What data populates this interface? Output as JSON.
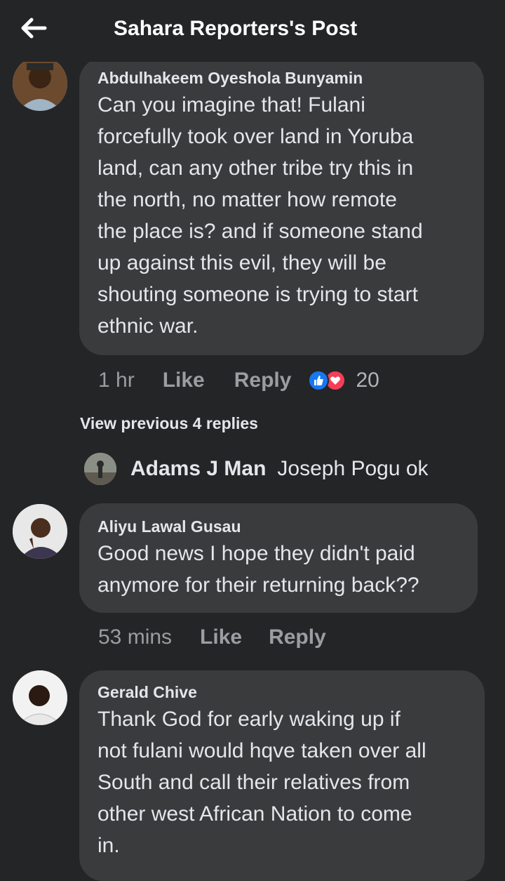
{
  "header": {
    "back_icon": "arrow-left-icon",
    "title": "Sahara Reporters's Post"
  },
  "comments": [
    {
      "author": "Abdulhakeem Oyeshola Bunyamin",
      "text": "Can you imagine that! Fulani\nforcefully took over land in Yoruba\nland, can any other tribe try this in\nthe north, no matter how remote\nthe place is? and if someone stand\nup against this evil, they will be\nshouting someone is trying to start\nethnic war.",
      "time": "1 hr",
      "like_label": "Like",
      "reply_label": "Reply",
      "reactions": [
        "like-icon",
        "love-icon"
      ],
      "reaction_count": "20"
    },
    {
      "author": "Aliyu Lawal Gusau",
      "text": "Good news I hope they didn't paid\nanymore for their returning back??",
      "time": "53 mins",
      "like_label": "Like",
      "reply_label": "Reply"
    },
    {
      "author": "Gerald Chive",
      "text": "Thank God for early waking up if\nnot fulani would hqve taken over all\nSouth and call their relatives from\nother west African Nation to come\nin."
    }
  ],
  "replies": {
    "view_previous": "View previous 4 replies",
    "latest": {
      "author": "Adams J Man",
      "text": "Joseph Pogu ok"
    }
  },
  "colors": {
    "background": "#242526",
    "bubble": "#3a3b3c",
    "text": "#e4e6eb",
    "muted": "#9a9da1",
    "like_blue": "#1877f2",
    "love_red": "#f33e58"
  }
}
